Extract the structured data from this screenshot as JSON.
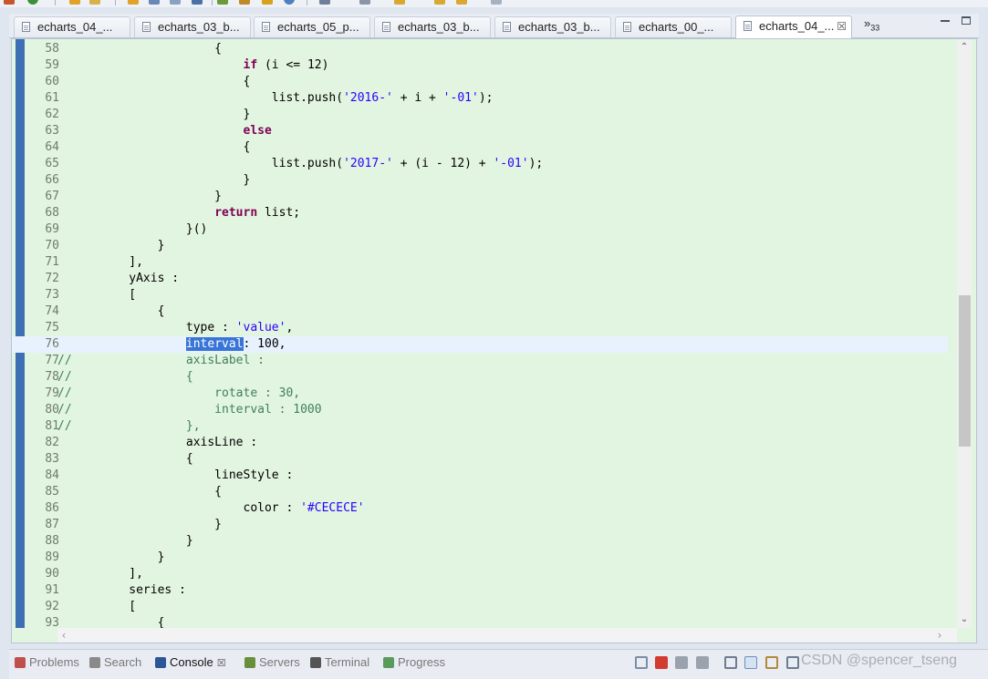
{
  "editor_tabs": [
    {
      "label": "echarts_04_...",
      "active": false
    },
    {
      "label": "echarts_03_b...",
      "active": false
    },
    {
      "label": "echarts_05_p...",
      "active": false
    },
    {
      "label": "echarts_03_b...",
      "active": false
    },
    {
      "label": "echarts_03_b...",
      "active": false
    },
    {
      "label": "echarts_00_...",
      "active": false
    },
    {
      "label": "echarts_04_...",
      "active": true
    }
  ],
  "overflow": {
    "chevron": "»",
    "count": "33"
  },
  "code": {
    "current_line": 76,
    "lines": [
      {
        "n": "58",
        "tokens": [
          [
            "p",
            "                      {"
          ]
        ]
      },
      {
        "n": "59",
        "tokens": [
          [
            "p",
            "                          "
          ],
          [
            "k",
            "if"
          ],
          [
            "p",
            " (i <= 12)"
          ]
        ]
      },
      {
        "n": "60",
        "tokens": [
          [
            "p",
            "                          {"
          ]
        ]
      },
      {
        "n": "61",
        "tokens": [
          [
            "p",
            "                              list.push("
          ],
          [
            "s",
            "'2016-'"
          ],
          [
            "p",
            " + i + "
          ],
          [
            "s",
            "'-01'"
          ],
          [
            "p",
            ");"
          ]
        ]
      },
      {
        "n": "62",
        "tokens": [
          [
            "p",
            "                          }"
          ]
        ]
      },
      {
        "n": "63",
        "tokens": [
          [
            "p",
            "                          "
          ],
          [
            "k",
            "else"
          ]
        ]
      },
      {
        "n": "64",
        "tokens": [
          [
            "p",
            "                          {"
          ]
        ]
      },
      {
        "n": "65",
        "tokens": [
          [
            "p",
            "                              list.push("
          ],
          [
            "s",
            "'2017-'"
          ],
          [
            "p",
            " + (i - 12) + "
          ],
          [
            "s",
            "'-01'"
          ],
          [
            "p",
            ");"
          ]
        ]
      },
      {
        "n": "66",
        "tokens": [
          [
            "p",
            "                          }"
          ]
        ]
      },
      {
        "n": "67",
        "tokens": [
          [
            "p",
            "                      }"
          ]
        ]
      },
      {
        "n": "68",
        "tokens": [
          [
            "p",
            "                      "
          ],
          [
            "k",
            "return"
          ],
          [
            "p",
            " list;"
          ]
        ]
      },
      {
        "n": "69",
        "tokens": [
          [
            "p",
            "                  }()"
          ]
        ]
      },
      {
        "n": "70",
        "tokens": [
          [
            "p",
            "              }"
          ]
        ]
      },
      {
        "n": "71",
        "tokens": [
          [
            "p",
            "          ],"
          ]
        ]
      },
      {
        "n": "72",
        "tokens": [
          [
            "p",
            "          yAxis :"
          ]
        ]
      },
      {
        "n": "73",
        "tokens": [
          [
            "p",
            "          ["
          ]
        ]
      },
      {
        "n": "74",
        "tokens": [
          [
            "p",
            "              {"
          ]
        ]
      },
      {
        "n": "75",
        "tokens": [
          [
            "p",
            "                  type : "
          ],
          [
            "s",
            "'value'"
          ],
          [
            "p",
            ","
          ]
        ]
      },
      {
        "n": "76",
        "tokens": [
          [
            "p",
            "                  "
          ],
          [
            "sel",
            "interval"
          ],
          [
            "p",
            ": 100,"
          ]
        ]
      },
      {
        "n": "77",
        "tokens": [
          [
            "c",
            "//                axisLabel :"
          ]
        ]
      },
      {
        "n": "78",
        "tokens": [
          [
            "c",
            "//                {"
          ]
        ]
      },
      {
        "n": "79",
        "tokens": [
          [
            "c",
            "//                    rotate : 30,"
          ]
        ]
      },
      {
        "n": "80",
        "tokens": [
          [
            "c",
            "//                    interval : 1000"
          ]
        ]
      },
      {
        "n": "81",
        "tokens": [
          [
            "c",
            "//                },"
          ]
        ]
      },
      {
        "n": "82",
        "tokens": [
          [
            "p",
            "                  axisLine :"
          ]
        ]
      },
      {
        "n": "83",
        "tokens": [
          [
            "p",
            "                  {"
          ]
        ]
      },
      {
        "n": "84",
        "tokens": [
          [
            "p",
            "                      lineStyle :"
          ]
        ]
      },
      {
        "n": "85",
        "tokens": [
          [
            "p",
            "                      {"
          ]
        ]
      },
      {
        "n": "86",
        "tokens": [
          [
            "p",
            "                          color : "
          ],
          [
            "s",
            "'#CECECE'"
          ]
        ]
      },
      {
        "n": "87",
        "tokens": [
          [
            "p",
            "                      }"
          ]
        ]
      },
      {
        "n": "88",
        "tokens": [
          [
            "p",
            "                  }"
          ]
        ]
      },
      {
        "n": "89",
        "tokens": [
          [
            "p",
            "              }"
          ]
        ]
      },
      {
        "n": "90",
        "tokens": [
          [
            "p",
            "          ],"
          ]
        ]
      },
      {
        "n": "91",
        "tokens": [
          [
            "p",
            "          series :"
          ]
        ]
      },
      {
        "n": "92",
        "tokens": [
          [
            "p",
            "          ["
          ]
        ]
      },
      {
        "n": "93",
        "tokens": [
          [
            "p",
            "              {"
          ]
        ]
      }
    ]
  },
  "bottom_views": [
    {
      "label": "Problems",
      "icon": "problems-icon",
      "active": false,
      "color": "#c0504d"
    },
    {
      "label": "Search",
      "icon": "search-icon",
      "active": false,
      "color": "#8a8a8a"
    },
    {
      "label": "Console",
      "icon": "console-icon",
      "active": true,
      "color": "#2b5797"
    },
    {
      "label": "Servers",
      "icon": "servers-icon",
      "active": false,
      "color": "#6a8f3a"
    },
    {
      "label": "Terminal",
      "icon": "terminal-icon",
      "active": false,
      "color": "#555555"
    },
    {
      "label": "Progress",
      "icon": "progress-icon",
      "active": false,
      "color": "#5a9a5a"
    }
  ],
  "watermark": "CSDN @spencer_tseng",
  "colors": {
    "editor_bg": "#e2f5e0",
    "current_line": "#e8f2fe",
    "keyword": "#7f0055",
    "string": "#2a00ff",
    "comment": "#3f7f5f",
    "selection": "#3875d7"
  }
}
